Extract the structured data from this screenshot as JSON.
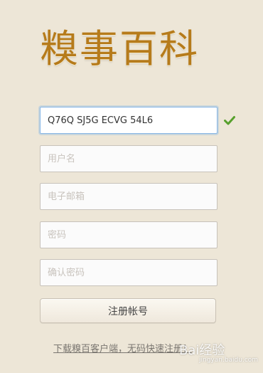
{
  "logo": {
    "text": "糗事百科"
  },
  "form": {
    "invite_code": {
      "value": "Q76Q SJ5G ECVG 54L6",
      "valid_icon": "check-icon",
      "valid_color": "#57a02c"
    },
    "username": {
      "placeholder": "用户名"
    },
    "email": {
      "placeholder": "电子邮箱"
    },
    "password": {
      "placeholder": "密码"
    },
    "confirm_password": {
      "placeholder": "确认密码"
    },
    "submit_label": "注册帐号"
  },
  "footer": {
    "download_link": "下载糗百客户端，无码快速注册！",
    "watermark": "Bai经验",
    "watermark_small": "jingyan.baidu.com"
  },
  "colors": {
    "background": "#ede6d7",
    "logo": "#b67b1b",
    "focus_border": "#86b6e6"
  }
}
